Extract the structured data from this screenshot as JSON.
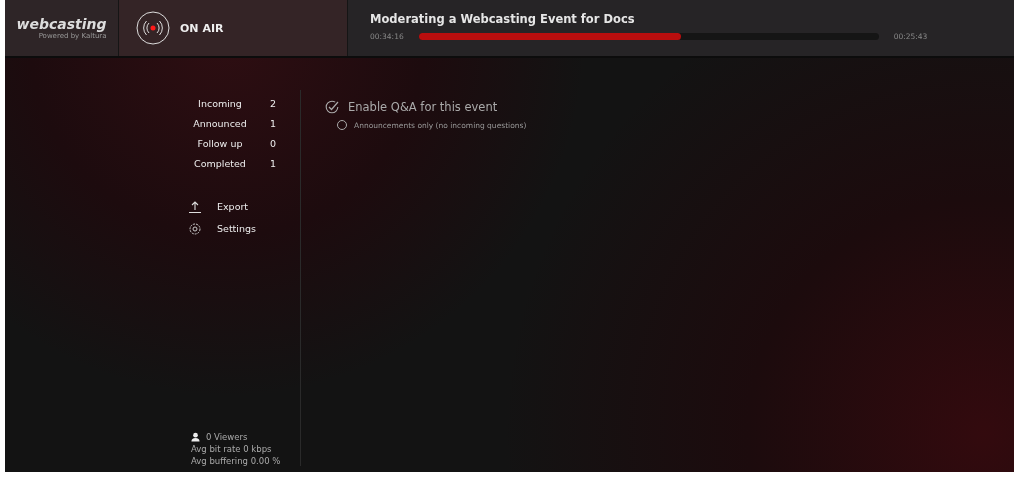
{
  "header": {
    "logo": {
      "name": "webcasting",
      "tagline": "Powered by Kaltura"
    },
    "status": {
      "label": "ON AIR",
      "live": true
    },
    "event": {
      "title": "Moderating a Webcasting Event for Docs",
      "elapsed": "00:34:16",
      "remaining": "00:25:43",
      "level": 0.57
    }
  },
  "sidebar": {
    "queues": [
      {
        "label": "Incoming",
        "count": "2"
      },
      {
        "label": "Announced",
        "count": "1"
      },
      {
        "label": "Follow up",
        "count": "0"
      },
      {
        "label": "Completed",
        "count": "1"
      }
    ],
    "actions": [
      {
        "kind": "export",
        "label": "Export"
      },
      {
        "kind": "settings",
        "label": "Settings"
      }
    ],
    "stats": {
      "viewers": "0 Viewers",
      "bitrate": "Avg bit rate 0 kbps",
      "buffering": "Avg buffering 0.00 %"
    }
  },
  "qa": {
    "enable": {
      "label": "Enable Q&A for this event",
      "checked": true
    },
    "announcements_only": {
      "label": "Announcements only (no incoming questions)",
      "selected": false
    }
  }
}
